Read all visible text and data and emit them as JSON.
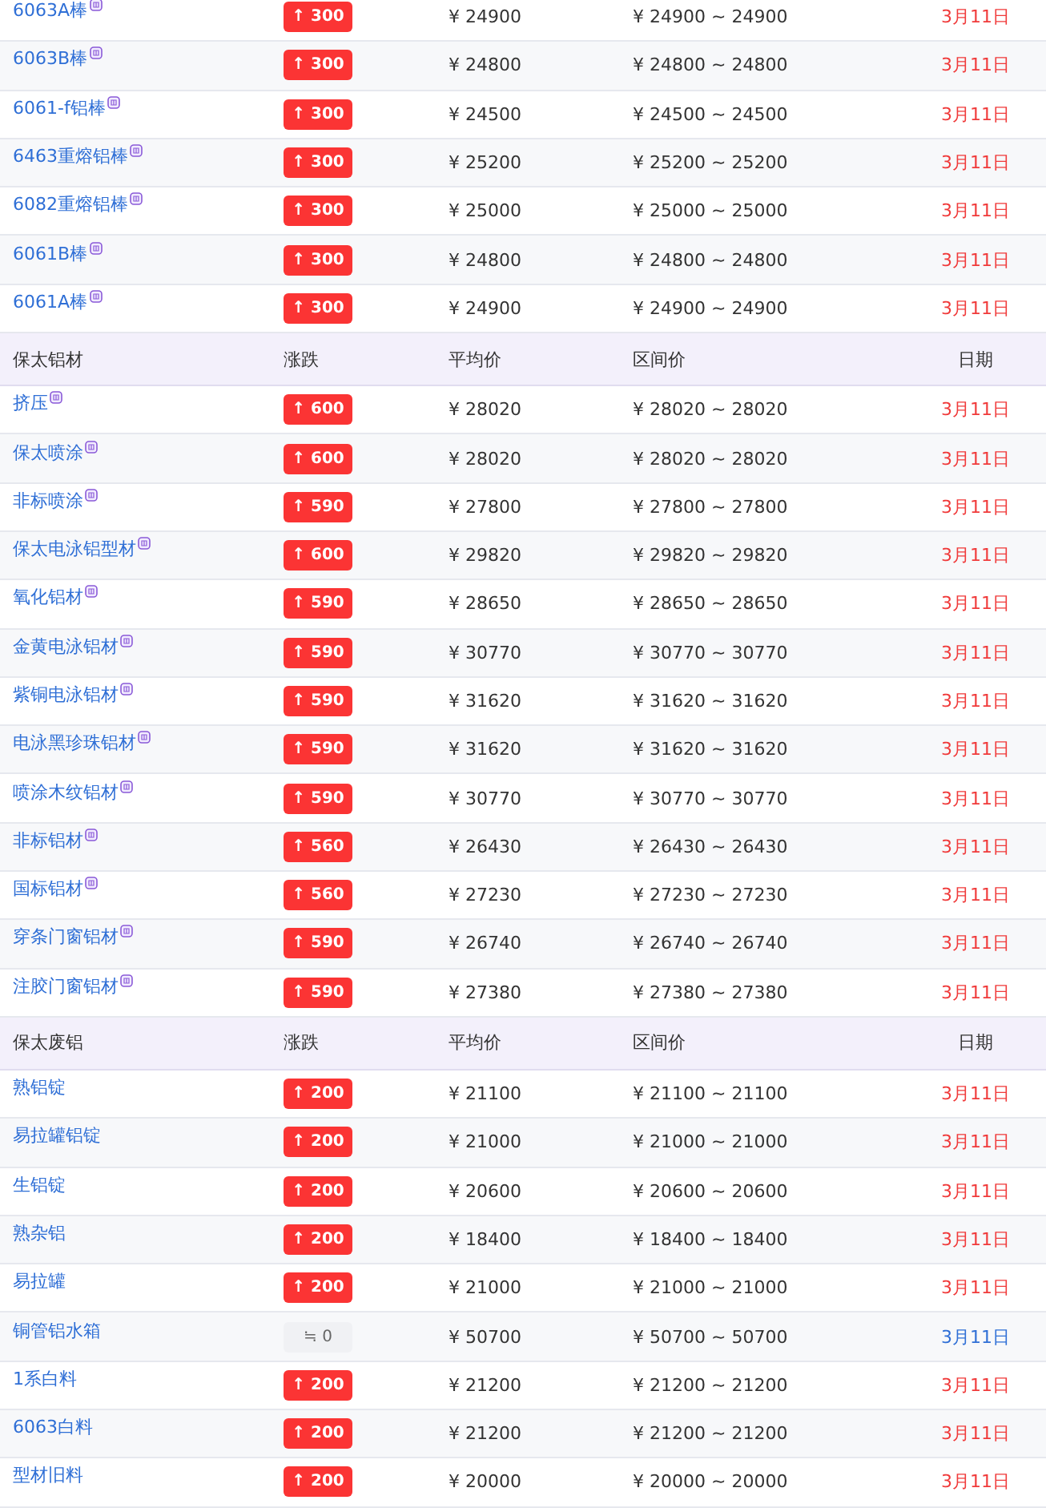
{
  "sections": [
    {
      "rows": [
        {
          "name": "6063A棒",
          "badge": true,
          "kind": "up",
          "change": "↑ 300",
          "avg": "¥ 24900",
          "range": "¥ 24900 ~ 24900",
          "date": "3月11日"
        },
        {
          "name": "6063B棒",
          "badge": true,
          "kind": "up",
          "change": "↑ 300",
          "avg": "¥ 24800",
          "range": "¥ 24800 ~ 24800",
          "date": "3月11日"
        },
        {
          "name": "6061-f铝棒",
          "badge": true,
          "kind": "up",
          "change": "↑ 300",
          "avg": "¥ 24500",
          "range": "¥ 24500 ~ 24500",
          "date": "3月11日"
        },
        {
          "name": "6463重熔铝棒",
          "badge": true,
          "kind": "up",
          "change": "↑ 300",
          "avg": "¥ 25200",
          "range": "¥ 25200 ~ 25200",
          "date": "3月11日"
        },
        {
          "name": "6082重熔铝棒",
          "badge": true,
          "kind": "up",
          "change": "↑ 300",
          "avg": "¥ 25000",
          "range": "¥ 25000 ~ 25000",
          "date": "3月11日"
        },
        {
          "name": "6061B棒",
          "badge": true,
          "kind": "up",
          "change": "↑ 300",
          "avg": "¥ 24800",
          "range": "¥ 24800 ~ 24800",
          "date": "3月11日"
        },
        {
          "name": "6061A棒",
          "badge": true,
          "kind": "up",
          "change": "↑ 300",
          "avg": "¥ 24900",
          "range": "¥ 24900 ~ 24900",
          "date": "3月11日"
        }
      ]
    },
    {
      "header": [
        "保太铝材",
        "涨跌",
        "平均价",
        "区间价",
        "日期"
      ],
      "rows": [
        {
          "name": "挤压",
          "badge": true,
          "kind": "up",
          "change": "↑ 600",
          "avg": "¥ 28020",
          "range": "¥ 28020 ~ 28020",
          "date": "3月11日"
        },
        {
          "name": "保太喷涂",
          "badge": true,
          "kind": "up",
          "change": "↑ 600",
          "avg": "¥ 28020",
          "range": "¥ 28020 ~ 28020",
          "date": "3月11日"
        },
        {
          "name": "非标喷涂",
          "badge": true,
          "kind": "up",
          "change": "↑ 590",
          "avg": "¥ 27800",
          "range": "¥ 27800 ~ 27800",
          "date": "3月11日"
        },
        {
          "name": "保太电泳铝型材",
          "badge": true,
          "kind": "up",
          "change": "↑ 600",
          "avg": "¥ 29820",
          "range": "¥ 29820 ~ 29820",
          "date": "3月11日"
        },
        {
          "name": "氧化铝材",
          "badge": true,
          "kind": "up",
          "change": "↑ 590",
          "avg": "¥ 28650",
          "range": "¥ 28650 ~ 28650",
          "date": "3月11日"
        },
        {
          "name": "金黄电泳铝材",
          "badge": true,
          "kind": "up",
          "change": "↑ 590",
          "avg": "¥ 30770",
          "range": "¥ 30770 ~ 30770",
          "date": "3月11日"
        },
        {
          "name": "紫铜电泳铝材",
          "badge": true,
          "kind": "up",
          "change": "↑ 590",
          "avg": "¥ 31620",
          "range": "¥ 31620 ~ 31620",
          "date": "3月11日"
        },
        {
          "name": "电泳黑珍珠铝材",
          "badge": true,
          "kind": "up",
          "change": "↑ 590",
          "avg": "¥ 31620",
          "range": "¥ 31620 ~ 31620",
          "date": "3月11日"
        },
        {
          "name": "喷涂木纹铝材",
          "badge": true,
          "kind": "up",
          "change": "↑ 590",
          "avg": "¥ 30770",
          "range": "¥ 30770 ~ 30770",
          "date": "3月11日"
        },
        {
          "name": "非标铝材",
          "badge": true,
          "kind": "up",
          "change": "↑ 560",
          "avg": "¥ 26430",
          "range": "¥ 26430 ~ 26430",
          "date": "3月11日"
        },
        {
          "name": "国标铝材",
          "badge": true,
          "kind": "up",
          "change": "↑ 560",
          "avg": "¥ 27230",
          "range": "¥ 27230 ~ 27230",
          "date": "3月11日"
        },
        {
          "name": "穿条门窗铝材",
          "badge": true,
          "kind": "up",
          "change": "↑ 590",
          "avg": "¥ 26740",
          "range": "¥ 26740 ~ 26740",
          "date": "3月11日"
        },
        {
          "name": "注胶门窗铝材",
          "badge": true,
          "kind": "up",
          "change": "↑ 590",
          "avg": "¥ 27380",
          "range": "¥ 27380 ~ 27380",
          "date": "3月11日"
        }
      ]
    },
    {
      "header": [
        "保太废铝",
        "涨跌",
        "平均价",
        "区间价",
        "日期"
      ],
      "rows": [
        {
          "name": "熟铝锭",
          "badge": false,
          "kind": "up",
          "change": "↑ 200",
          "avg": "¥ 21100",
          "range": "¥ 21100 ~ 21100",
          "date": "3月11日"
        },
        {
          "name": "易拉罐铝锭",
          "badge": false,
          "kind": "up",
          "change": "↑ 200",
          "avg": "¥ 21000",
          "range": "¥ 21000 ~ 21000",
          "date": "3月11日"
        },
        {
          "name": "生铝锭",
          "badge": false,
          "kind": "up",
          "change": "↑ 200",
          "avg": "¥ 20600",
          "range": "¥ 20600 ~ 20600",
          "date": "3月11日"
        },
        {
          "name": "熟杂铝",
          "badge": false,
          "kind": "up",
          "change": "↑ 200",
          "avg": "¥ 18400",
          "range": "¥ 18400 ~ 18400",
          "date": "3月11日"
        },
        {
          "name": "易拉罐",
          "badge": false,
          "kind": "up",
          "change": "↑ 200",
          "avg": "¥ 21000",
          "range": "¥ 21000 ~ 21000",
          "date": "3月11日"
        },
        {
          "name": "铜管铝水箱",
          "badge": false,
          "kind": "flat",
          "change": "≒ 0",
          "avg": "¥ 50700",
          "range": "¥ 50700 ~ 50700",
          "date": "3月11日"
        },
        {
          "name": "1系白料",
          "badge": false,
          "kind": "up",
          "change": "↑ 200",
          "avg": "¥ 21200",
          "range": "¥ 21200 ~ 21200",
          "date": "3月11日"
        },
        {
          "name": "6063白料",
          "badge": false,
          "kind": "up",
          "change": "↑ 200",
          "avg": "¥ 21200",
          "range": "¥ 21200 ~ 21200",
          "date": "3月11日"
        },
        {
          "name": "型材旧料",
          "badge": false,
          "kind": "up",
          "change": "↑ 200",
          "avg": "¥ 20000",
          "range": "¥ 20000 ~ 20000",
          "date": "3月11日"
        }
      ]
    }
  ]
}
